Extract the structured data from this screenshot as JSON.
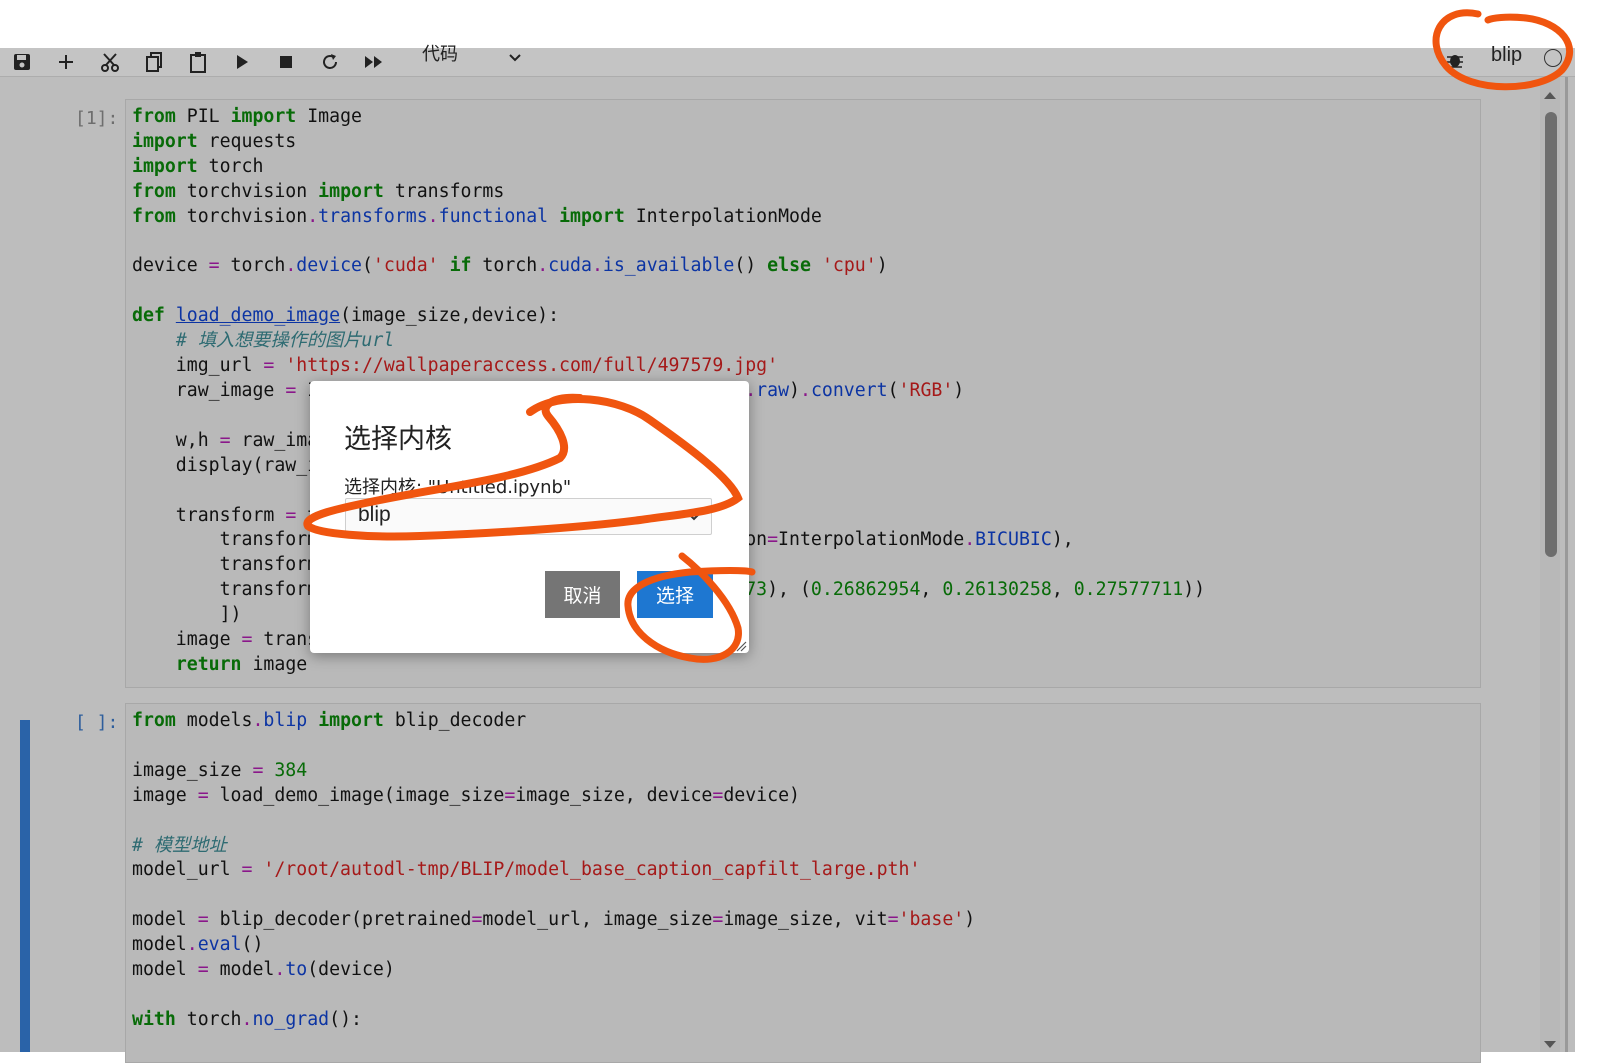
{
  "toolbar": {
    "icons": [
      "save-icon",
      "plus-icon",
      "cut-icon",
      "copy-icon",
      "paste-icon",
      "run-icon",
      "stop-icon",
      "restart-icon",
      "fast-forward-icon"
    ],
    "cell_type": "代码",
    "kernel_name": "blip"
  },
  "cells": [
    {
      "prompt": "[1]:",
      "lines": [
        "from PIL import Image",
        "import requests",
        "import torch",
        "from torchvision import transforms",
        "from torchvision.transforms.functional import InterpolationMode",
        "",
        "device = torch.device('cuda' if torch.cuda.is_available() else 'cpu')",
        "",
        "def load_demo_image(image_size,device):",
        "    # 填入想要操作的图片url",
        "    img_url = 'https://wallpaperaccess.com/full/497579.jpg'",
        "    raw_image = I(partially hidden)e).raw).convert('RGB')",
        "",
        "    w,h = raw_ima",
        "    display(raw_i",
        "",
        "    transform = t",
        "        transform(partially hidden)tion=InterpolationMode.BICUBIC),",
        "        transform",
        "        transform(partially hidden)1073), (0.26862954, 0.26130258, 0.27577711))",
        "        ])",
        "    image = trans",
        "    return image"
      ]
    },
    {
      "prompt": "[ ]:",
      "lines": [
        "from models.blip import blip_decoder",
        "",
        "image_size = 384",
        "image = load_demo_image(image_size=image_size, device=device)",
        "",
        "# 模型地址",
        "model_url = '/root/autodl-tmp/BLIP/model_base_caption_capfilt_large.pth'",
        "",
        "model = blip_decoder(pretrained=model_url, image_size=image_size, vit='base')",
        "model.eval()",
        "model = model.to(device)",
        "",
        "with torch.no_grad():"
      ]
    }
  ],
  "modal": {
    "title": "选择内核",
    "label": "选择内核: \"Untitled.ipynb\"",
    "select_value": "blip",
    "cancel_label": "取消",
    "select_label": "选择"
  },
  "colors": {
    "annotation": "#f0550f",
    "primary_button": "#1e77d1",
    "cancel_button": "#757575",
    "active_cell_bar": "#2a63a8"
  }
}
